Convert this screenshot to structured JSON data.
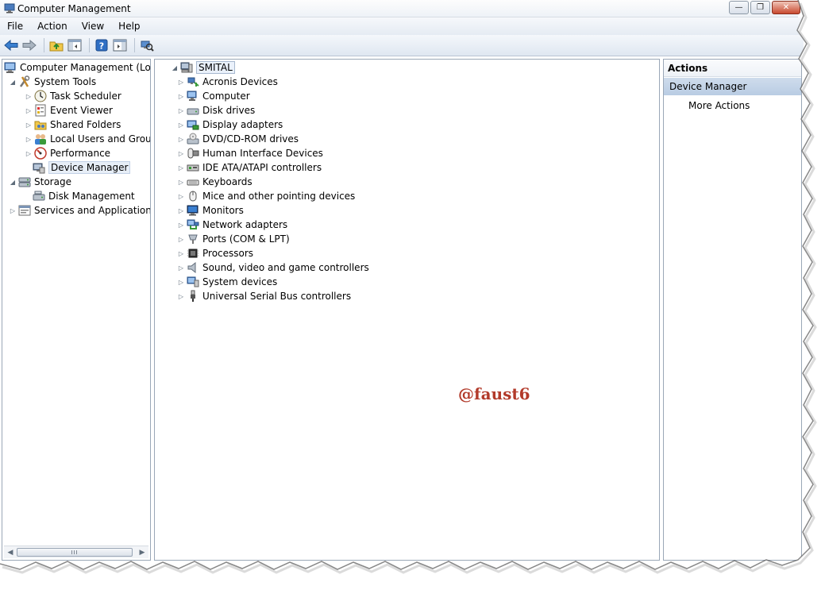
{
  "window": {
    "title": "Computer Management"
  },
  "menu": [
    "File",
    "Action",
    "View",
    "Help"
  ],
  "toolbar": {
    "buttons": [
      "back-icon",
      "forward-icon",
      "up-folder-icon",
      "show-hide-console-tree-icon",
      "help-icon",
      "show-hide-action-pane-icon",
      "scan-hardware-icon"
    ]
  },
  "left_tree": {
    "root": "Computer Management (Local",
    "system_tools": "System Tools",
    "task_scheduler": "Task Scheduler",
    "event_viewer": "Event Viewer",
    "shared_folders": "Shared Folders",
    "local_users": "Local Users and Groups",
    "performance": "Performance",
    "device_manager": "Device Manager",
    "storage": "Storage",
    "disk_management": "Disk Management",
    "services": "Services and Applications",
    "scroll_grip": "III"
  },
  "device_tree": {
    "computer_name": "SMITAL",
    "categories": [
      "Acronis Devices",
      "Computer",
      "Disk drives",
      "Display adapters",
      "DVD/CD-ROM drives",
      "Human Interface Devices",
      "IDE ATA/ATAPI controllers",
      "Keyboards",
      "Mice and other pointing devices",
      "Monitors",
      "Network adapters",
      "Ports (COM & LPT)",
      "Processors",
      "Sound, video and game controllers",
      "System devices",
      "Universal Serial Bus controllers"
    ]
  },
  "actions": {
    "header": "Actions",
    "section": "Device Manager",
    "more": "More Actions"
  },
  "watermark": "@faust6",
  "colors": {
    "selection": "#e7eef7",
    "actions_section": "#c4d4e8",
    "watermark": "#b23a2a"
  }
}
